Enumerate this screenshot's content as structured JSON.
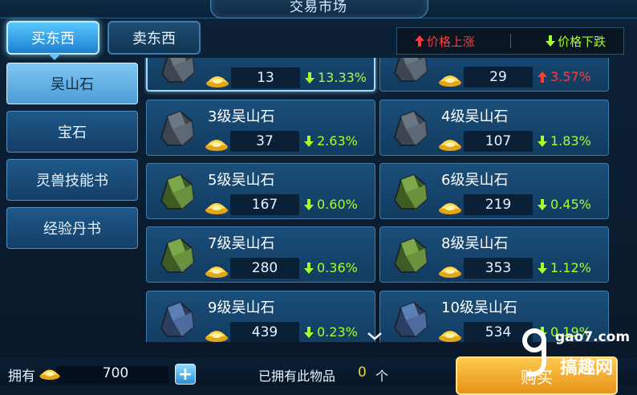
{
  "title": "交易市场",
  "tabs": {
    "buy": "买东西",
    "sell": "卖东西"
  },
  "legend": {
    "up": "价格上涨",
    "down": "价格下跌"
  },
  "categories": [
    "吴山石",
    "宝石",
    "灵兽技能书",
    "经验丹书"
  ],
  "items": [
    {
      "name": "",
      "price": "13",
      "change": "13.33%",
      "dir": "down",
      "stone": "gray"
    },
    {
      "name": "",
      "price": "29",
      "change": "3.57%",
      "dir": "up",
      "stone": "gray"
    },
    {
      "name": "3级吴山石",
      "price": "37",
      "change": "2.63%",
      "dir": "down",
      "stone": "gray"
    },
    {
      "name": "4级吴山石",
      "price": "107",
      "change": "1.83%",
      "dir": "down",
      "stone": "gray"
    },
    {
      "name": "5级吴山石",
      "price": "167",
      "change": "0.60%",
      "dir": "down",
      "stone": "green"
    },
    {
      "name": "6级吴山石",
      "price": "219",
      "change": "0.45%",
      "dir": "down",
      "stone": "green"
    },
    {
      "name": "7级吴山石",
      "price": "280",
      "change": "0.36%",
      "dir": "down",
      "stone": "green"
    },
    {
      "name": "8级吴山石",
      "price": "353",
      "change": "1.12%",
      "dir": "down",
      "stone": "green"
    },
    {
      "name": "9级吴山石",
      "price": "439",
      "change": "0.23%",
      "dir": "down",
      "stone": "blue"
    },
    {
      "name": "10级吴山石",
      "price": "534",
      "change": "0.19%",
      "dir": "down",
      "stone": "blue"
    }
  ],
  "bottom": {
    "own_label": "拥有",
    "own_value": "700",
    "owned_label": "已拥有此物品",
    "owned_count": "0",
    "owned_unit": "个",
    "buy_label": "购买"
  },
  "watermark": {
    "url": "gao7.com",
    "text": "搞趣网"
  },
  "colors": {
    "up": "#ff3a3a",
    "down": "#a6ff2a",
    "accent": "#58c8ff",
    "buy": "#f2a52a"
  }
}
